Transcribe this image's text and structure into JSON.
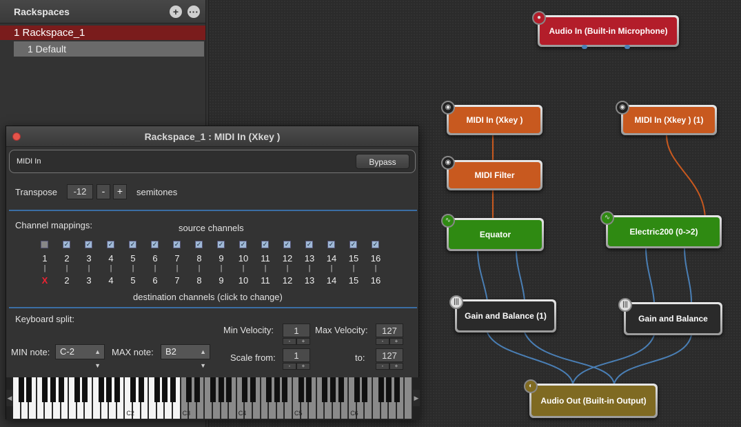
{
  "sidebar": {
    "title": "Rackspaces",
    "add_icon": "plus-icon",
    "more_icon": "ellipsis-icon",
    "rackspace": "1 Rackspace_1",
    "variation": "1  Default"
  },
  "plugin": {
    "title": "Rackspace_1 : MIDI In (Xkey  )",
    "plugin_name": "MIDI In",
    "bypass": "Bypass",
    "transpose_label": "Transpose",
    "transpose_value": "-12",
    "minus": "-",
    "plus": "+",
    "semitones": "semitones",
    "channel_mappings": "Channel mappings:",
    "source_channels": "source channels",
    "destination_channels": "destination channels (click to change)",
    "channels_src": [
      "1",
      "2",
      "3",
      "4",
      "5",
      "6",
      "7",
      "8",
      "9",
      "10",
      "11",
      "12",
      "13",
      "14",
      "15",
      "16"
    ],
    "channels_dst": [
      "X",
      "2",
      "3",
      "4",
      "5",
      "6",
      "7",
      "8",
      "9",
      "10",
      "11",
      "12",
      "13",
      "14",
      "15",
      "16"
    ],
    "keyboard_split": "Keyboard split:",
    "min_note_label": "MIN note:",
    "min_note": "C-2",
    "max_note_label": "MAX note:",
    "max_note": "B2",
    "min_velocity_label": "Min Velocity:",
    "min_velocity": "1",
    "max_velocity_label": "Max Velocity:",
    "max_velocity": "127",
    "scale_from_label": "Scale from:",
    "scale_from": "1",
    "to_label": "to:",
    "to_value": "127",
    "octave_labels": [
      "C2",
      "C3",
      "C4",
      "C5",
      "C6"
    ]
  },
  "nodes": {
    "audio_in": "Audio In (Built-in Microphone)",
    "midi_in_1": "MIDI In (Xkey  )",
    "midi_in_2": "MIDI In (Xkey  ) (1)",
    "midi_filter": "MIDI Filter",
    "equator": "Equator",
    "electric": "Electric200 (0->2)",
    "gain1": "Gain and Balance (1)",
    "gain2": "Gain and Balance",
    "audio_out": "Audio Out (Built-in Output)"
  },
  "colors": {
    "audio_in": "#b31d2a",
    "midi": "#c8591f",
    "synth": "#2f8a12",
    "gain": "#2a2a2a",
    "audio_out": "#7f6a22",
    "selected_row": "#7a1c1c",
    "wire_midi": "#c8591f",
    "wire_audio": "#4a7fb5"
  }
}
